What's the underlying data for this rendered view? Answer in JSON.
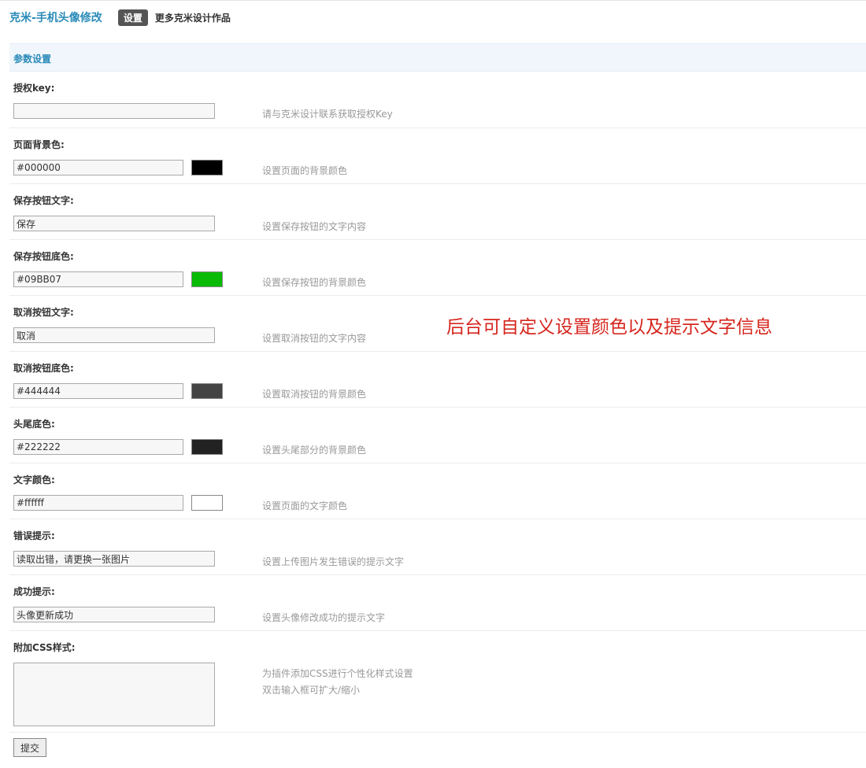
{
  "header": {
    "plugin_title": "克米-手机头像修改",
    "tab_active": "设置",
    "tab_more": "更多克米设计作品"
  },
  "section": {
    "title": "参数设置"
  },
  "fields": {
    "auth_key": {
      "label": "授权key:",
      "value": "",
      "hint": "请与克米设计联系获取授权Key"
    },
    "bg_color": {
      "label": "页面背景色:",
      "value": "#000000",
      "swatch": "#000000",
      "hint": "设置页面的背景颜色"
    },
    "save_text": {
      "label": "保存按钮文字:",
      "value": "保存",
      "hint": "设置保存按钮的文字内容"
    },
    "save_color": {
      "label": "保存按钮底色:",
      "value": "#09BB07",
      "swatch": "#09BB07",
      "hint": "设置保存按钮的背景颜色"
    },
    "cancel_text": {
      "label": "取消按钮文字:",
      "value": "取消",
      "hint": "设置取消按钮的文字内容"
    },
    "cancel_color": {
      "label": "取消按钮底色:",
      "value": "#444444",
      "swatch": "#444444",
      "hint": "设置取消按钮的背景颜色"
    },
    "header_footer_color": {
      "label": "头尾底色:",
      "value": "#222222",
      "swatch": "#222222",
      "hint": "设置头尾部分的背景颜色"
    },
    "text_color": {
      "label": "文字颜色:",
      "value": "#ffffff",
      "swatch": "#ffffff",
      "hint": "设置页面的文字颜色"
    },
    "error_tip": {
      "label": "错误提示:",
      "value": "读取出错，请更换一张图片",
      "hint": "设置上传图片发生错误的提示文字"
    },
    "success_tip": {
      "label": "成功提示:",
      "value": "头像更新成功",
      "hint": "设置头像修改成功的提示文字"
    },
    "extra_css": {
      "label": "附加CSS样式:",
      "value": "",
      "hint_line1": "为插件添加CSS进行个性化样式设置",
      "hint_line2": "双击输入框可扩大/缩小"
    }
  },
  "submit_label": "提交",
  "annotation": "后台可自定义设置颜色以及提示文字信息"
}
